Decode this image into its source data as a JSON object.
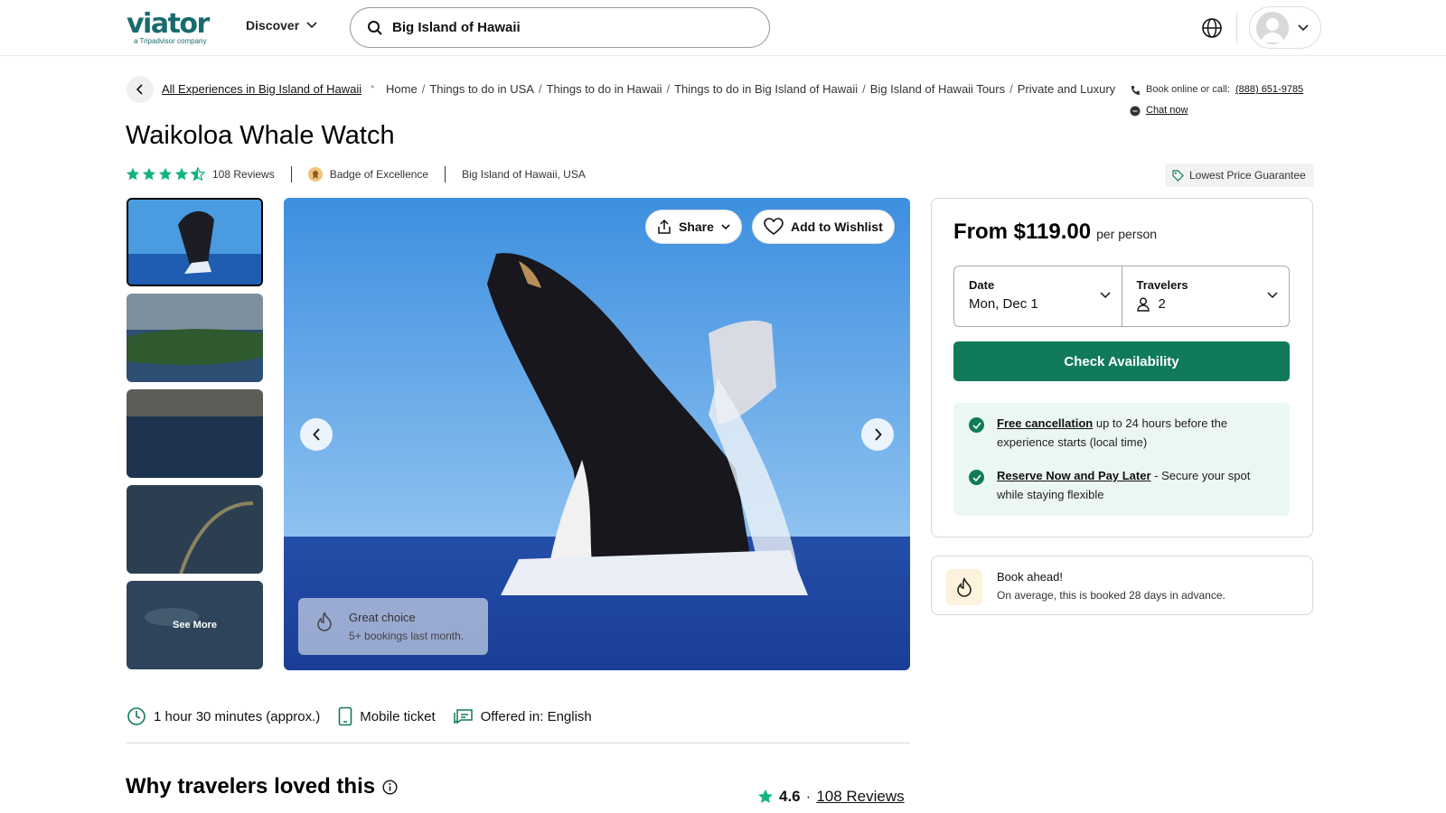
{
  "header": {
    "logo_text": "viator",
    "logo_sub": "a Tripadvisor company",
    "discover_label": "Discover",
    "search_value": "Big Island of Hawaii"
  },
  "breadcrumb": {
    "back_link": "All Experiences in Big Island of Hawaii",
    "items": [
      "Home",
      "Things to do in USA",
      "Things to do in Hawaii",
      "Things to do in Big Island of Hawaii",
      "Big Island of Hawaii Tours",
      "Private and Luxury"
    ]
  },
  "contact": {
    "book_text": "Book online or call:",
    "phone": "(888) 651-9785",
    "chat": "Chat now"
  },
  "product": {
    "title": "Waikoloa Whale Watch",
    "rating_stars": 4.5,
    "reviews_count": "108 Reviews",
    "badge": "Badge of Excellence",
    "location": "Big Island of Hawaii, USA",
    "lowest_price": "Lowest Price Guarantee"
  },
  "gallery": {
    "share_label": "Share",
    "wishlist_label": "Add to Wishlist",
    "see_more": "See More",
    "great_choice_title": "Great choice",
    "great_choice_sub": "5+ bookings last month."
  },
  "booking": {
    "from_price": "From $119.00",
    "per_person": "per person",
    "date_label": "Date",
    "date_value": "Mon, Dec 1",
    "travelers_label": "Travelers",
    "travelers_value": "2",
    "check_label": "Check Availability",
    "perk1_link": "Free cancellation",
    "perk1_text": "up to 24 hours before the experience starts (local time)",
    "perk2_link": "Reserve Now and Pay Later",
    "perk2_text": "- Secure your spot while staying flexible"
  },
  "book_ahead": {
    "title": "Book ahead!",
    "text": "On average, this is booked 28 days in advance."
  },
  "features": {
    "duration": "1 hour 30 minutes (approx.)",
    "ticket": "Mobile ticket",
    "language": "Offered in: English"
  },
  "why": {
    "title": "Why travelers loved this",
    "rating": "4.6",
    "dot": "·",
    "reviews_link": "108 Reviews"
  },
  "colors": {
    "brand": "#186b6d",
    "accent_green": "#117a5a",
    "star_green": "#11b37f"
  },
  "icons": [
    "search-icon",
    "chevron-down-icon",
    "globe-icon",
    "avatar-icon",
    "chevron-left-icon",
    "phone-icon",
    "chat-icon",
    "star-icon",
    "badge-icon",
    "tag-icon",
    "share-icon",
    "heart-icon",
    "chevron-right-icon",
    "flame-icon",
    "person-icon",
    "check-icon",
    "clock-icon",
    "phone-ticket-icon",
    "language-icon",
    "info-icon"
  ]
}
